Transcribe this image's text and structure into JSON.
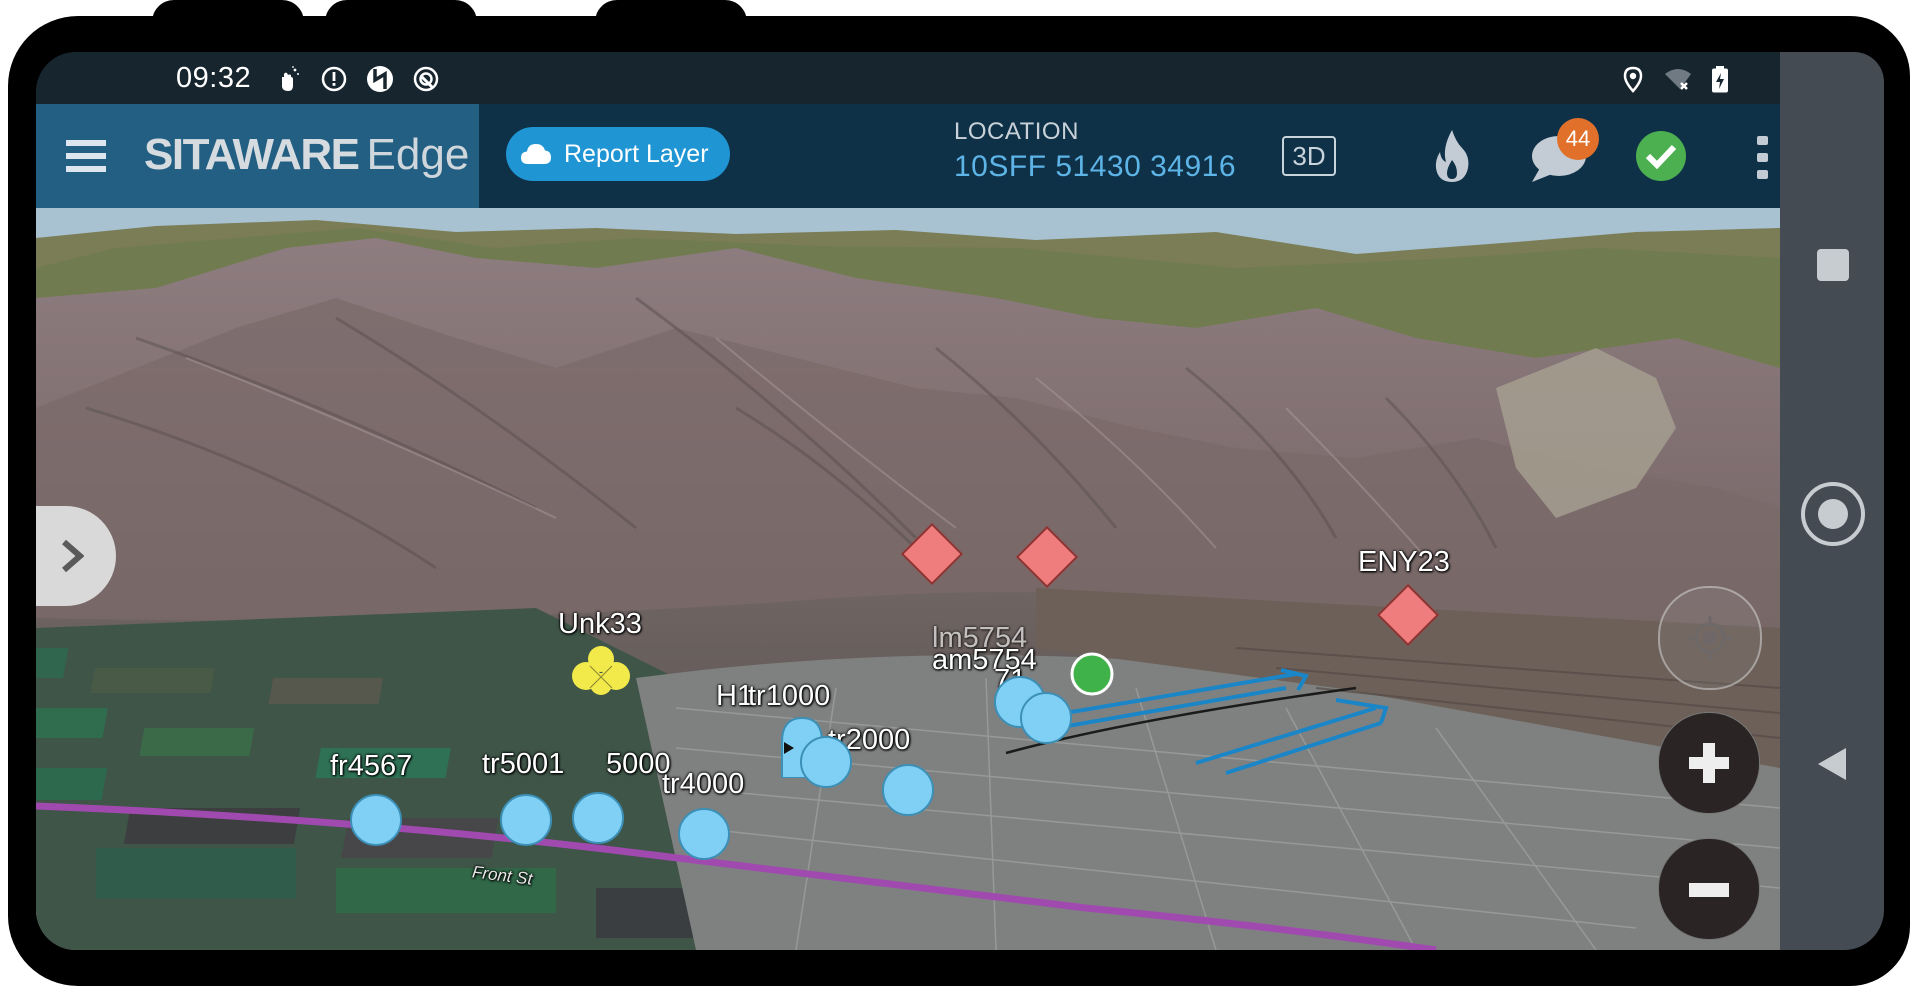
{
  "status_bar": {
    "time": "09:32",
    "left_icons": [
      "gesture-hand-icon",
      "alert-circle-icon",
      "sync-off-icon",
      "data-saver-icon"
    ],
    "right_icons": [
      "location-pin-icon",
      "wifi-off-icon",
      "battery-charging-icon"
    ]
  },
  "header": {
    "menu_icon": "hamburger-menu-icon",
    "brand_strong": "SITAWARE",
    "brand_light": "Edge",
    "report_layer_button": {
      "icon": "cloud-icon",
      "label": "Report Layer"
    },
    "location": {
      "label": "LOCATION",
      "value": "10SFF 51430 34916"
    },
    "view_mode_button": "3D",
    "fire_icon": "flame-icon",
    "messages": {
      "icon": "chat-bubble-icon",
      "badge_count": "44"
    },
    "status_icon": "check-circle-icon",
    "overflow_icon": "more-vertical-icon"
  },
  "colors": {
    "header_bg": "#0f3148",
    "brand_bg": "#225f82",
    "accent_blue": "#1f95d3",
    "location_text": "#5db4e6",
    "badge_orange": "#e0702a",
    "status_green": "#4caf50",
    "friendly_unit": "#7fd0f4",
    "hostile_unit": "#f07d7d",
    "unknown_unit": "#f2ea4a",
    "route_line": "#1a86c8",
    "road_purple": "#a04ab0"
  },
  "map": {
    "road_label": "Front St",
    "expand_panel_icon": "chevron-right-icon",
    "controls": {
      "locate": "crosshair-icon",
      "zoom_in": "plus-icon",
      "zoom_out": "minus-icon"
    },
    "labels": {
      "fr4567": "fr4567",
      "tr5001": "tr5001",
      "n5000": "5000",
      "unk33": "Unk33",
      "tr4000": "tr4000",
      "h1": "H1",
      "tr1000": "tr1000",
      "tr2000": "tr2000",
      "lm": "lm5754",
      "am5754": "am5754",
      "n71": "71",
      "eny23": "ENY23"
    }
  },
  "nav_bar": {
    "recents_icon": "square-icon",
    "home_icon": "circle-home-icon",
    "back_icon": "triangle-back-icon"
  }
}
